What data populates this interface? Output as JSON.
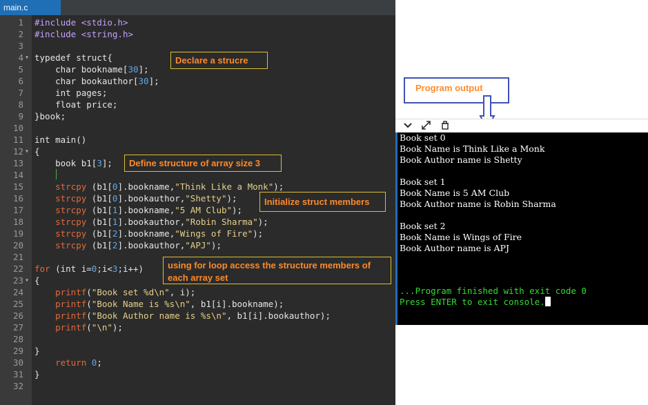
{
  "editor": {
    "tab": "main.c",
    "lines": [
      {
        "n": "1",
        "fold": "",
        "segs": [
          {
            "t": "#include ",
            "c": "inc"
          },
          {
            "t": "<stdio.h>",
            "c": "inc"
          }
        ]
      },
      {
        "n": "2",
        "fold": "",
        "segs": [
          {
            "t": "#include ",
            "c": "inc"
          },
          {
            "t": "<string.h>",
            "c": "inc"
          }
        ]
      },
      {
        "n": "3",
        "fold": "",
        "segs": []
      },
      {
        "n": "4",
        "fold": "▾",
        "segs": [
          {
            "t": "typedef struct{",
            "c": "kw"
          }
        ]
      },
      {
        "n": "5",
        "fold": "",
        "segs": [
          {
            "t": "    char bookname[",
            "c": "kw"
          },
          {
            "t": "30",
            "c": "num"
          },
          {
            "t": "];",
            "c": "kw"
          }
        ]
      },
      {
        "n": "6",
        "fold": "",
        "segs": [
          {
            "t": "    char bookauthor[",
            "c": "kw"
          },
          {
            "t": "30",
            "c": "num"
          },
          {
            "t": "];",
            "c": "kw"
          }
        ]
      },
      {
        "n": "7",
        "fold": "",
        "segs": [
          {
            "t": "    int pages;",
            "c": "kw"
          }
        ]
      },
      {
        "n": "8",
        "fold": "",
        "segs": [
          {
            "t": "    float price;",
            "c": "kw"
          }
        ]
      },
      {
        "n": "9",
        "fold": "",
        "segs": [
          {
            "t": "}book;",
            "c": "kw"
          }
        ]
      },
      {
        "n": "10",
        "fold": "",
        "segs": []
      },
      {
        "n": "11",
        "fold": "",
        "segs": [
          {
            "t": "int main()",
            "c": "kw"
          }
        ]
      },
      {
        "n": "12",
        "fold": "▾",
        "segs": [
          {
            "t": "{",
            "c": "kw"
          }
        ]
      },
      {
        "n": "13",
        "fold": "",
        "segs": [
          {
            "t": "    book b1[",
            "c": "kw"
          },
          {
            "t": "3",
            "c": "num"
          },
          {
            "t": "];",
            "c": "kw"
          }
        ]
      },
      {
        "n": "14",
        "fold": "",
        "segs": []
      },
      {
        "n": "15",
        "fold": "",
        "segs": [
          {
            "t": "    strcpy",
            "c": "fn"
          },
          {
            "t": " (b1[",
            "c": "kw"
          },
          {
            "t": "0",
            "c": "num"
          },
          {
            "t": "].bookname,",
            "c": "kw"
          },
          {
            "t": "\"Think Like a Monk\"",
            "c": "str"
          },
          {
            "t": ");",
            "c": "kw"
          }
        ]
      },
      {
        "n": "16",
        "fold": "",
        "segs": [
          {
            "t": "    strcpy",
            "c": "fn"
          },
          {
            "t": " (b1[",
            "c": "kw"
          },
          {
            "t": "0",
            "c": "num"
          },
          {
            "t": "].bookauthor,",
            "c": "kw"
          },
          {
            "t": "\"Shetty\"",
            "c": "str"
          },
          {
            "t": ");",
            "c": "kw"
          }
        ]
      },
      {
        "n": "17",
        "fold": "",
        "segs": [
          {
            "t": "    strcpy",
            "c": "fn"
          },
          {
            "t": " (b1[",
            "c": "kw"
          },
          {
            "t": "1",
            "c": "num"
          },
          {
            "t": "].bookname,",
            "c": "kw"
          },
          {
            "t": "\"5 AM Club\"",
            "c": "str"
          },
          {
            "t": ");",
            "c": "kw"
          }
        ]
      },
      {
        "n": "18",
        "fold": "",
        "segs": [
          {
            "t": "    strcpy",
            "c": "fn"
          },
          {
            "t": " (b1[",
            "c": "kw"
          },
          {
            "t": "1",
            "c": "num"
          },
          {
            "t": "].bookauthor,",
            "c": "kw"
          },
          {
            "t": "\"Robin Sharma\"",
            "c": "str"
          },
          {
            "t": ");",
            "c": "kw"
          }
        ]
      },
      {
        "n": "19",
        "fold": "",
        "segs": [
          {
            "t": "    strcpy",
            "c": "fn"
          },
          {
            "t": " (b1[",
            "c": "kw"
          },
          {
            "t": "2",
            "c": "num"
          },
          {
            "t": "].bookname,",
            "c": "kw"
          },
          {
            "t": "\"Wings of Fire\"",
            "c": "str"
          },
          {
            "t": ");",
            "c": "kw"
          }
        ]
      },
      {
        "n": "20",
        "fold": "",
        "segs": [
          {
            "t": "    strcpy",
            "c": "fn"
          },
          {
            "t": " (b1[",
            "c": "kw"
          },
          {
            "t": "2",
            "c": "num"
          },
          {
            "t": "].bookauthor,",
            "c": "kw"
          },
          {
            "t": "\"APJ\"",
            "c": "str"
          },
          {
            "t": ");",
            "c": "kw"
          }
        ]
      },
      {
        "n": "21",
        "fold": "",
        "segs": []
      },
      {
        "n": "22",
        "fold": "",
        "segs": [
          {
            "t": "for",
            "c": "fn"
          },
          {
            "t": " (int i=",
            "c": "kw"
          },
          {
            "t": "0",
            "c": "num"
          },
          {
            "t": ";i<",
            "c": "kw"
          },
          {
            "t": "3",
            "c": "num"
          },
          {
            "t": ";i++)",
            "c": "kw"
          }
        ]
      },
      {
        "n": "23",
        "fold": "▾",
        "segs": [
          {
            "t": "{",
            "c": "kw"
          }
        ]
      },
      {
        "n": "24",
        "fold": "",
        "segs": [
          {
            "t": "    printf",
            "c": "fn"
          },
          {
            "t": "(",
            "c": "kw"
          },
          {
            "t": "\"Book set %d\\n\"",
            "c": "str"
          },
          {
            "t": ", i);",
            "c": "kw"
          }
        ]
      },
      {
        "n": "25",
        "fold": "",
        "segs": [
          {
            "t": "    printf",
            "c": "fn"
          },
          {
            "t": "(",
            "c": "kw"
          },
          {
            "t": "\"Book Name is %s\\n\"",
            "c": "str"
          },
          {
            "t": ", b1[i].bookname);",
            "c": "kw"
          }
        ]
      },
      {
        "n": "26",
        "fold": "",
        "segs": [
          {
            "t": "    printf",
            "c": "fn"
          },
          {
            "t": "(",
            "c": "kw"
          },
          {
            "t": "\"Book Author name is %s\\n\"",
            "c": "str"
          },
          {
            "t": ", b1[i].bookauthor);",
            "c": "kw"
          }
        ]
      },
      {
        "n": "27",
        "fold": "",
        "segs": [
          {
            "t": "    printf",
            "c": "fn"
          },
          {
            "t": "(",
            "c": "kw"
          },
          {
            "t": "\"\\n\"",
            "c": "str"
          },
          {
            "t": ");",
            "c": "kw"
          }
        ]
      },
      {
        "n": "28",
        "fold": "",
        "segs": []
      },
      {
        "n": "29",
        "fold": "",
        "segs": [
          {
            "t": "}",
            "c": "kw"
          }
        ]
      },
      {
        "n": "30",
        "fold": "",
        "segs": [
          {
            "t": "    return ",
            "c": "fn"
          },
          {
            "t": "0",
            "c": "num"
          },
          {
            "t": ";",
            "c": "kw"
          }
        ]
      },
      {
        "n": "31",
        "fold": "",
        "segs": [
          {
            "t": "}",
            "c": "kw"
          }
        ]
      },
      {
        "n": "32",
        "fold": "",
        "segs": []
      }
    ]
  },
  "annotations": {
    "declare": "Declare a strucre",
    "define": "Define structure of array size 3",
    "initialize": "Initialize struct members",
    "loop": "using for loop access the structure members of each array set",
    "output": "Program output"
  },
  "console": {
    "toolbar_icons": [
      "chevron-down-icon",
      "expand-icon",
      "clear-console-icon"
    ],
    "lines": [
      "Book set 0",
      "Book Name is Think Like a Monk",
      "Book Author name is Shetty",
      "",
      "Book set 1",
      "Book Name is 5 AM Club",
      "Book Author name is Robin Sharma",
      "",
      "Book set 2",
      "Book Name is Wings of Fire",
      "Book Author name is APJ"
    ],
    "finished": "...Program finished with exit code 0",
    "prompt": "Press ENTER to exit console."
  },
  "colors": {
    "tab_active": "#1f6fb7",
    "editor_bg": "#2b2b2b",
    "annotation_border": "#e0c030",
    "annotation_text": "#ff8a2a",
    "console_green": "#33dd33",
    "arrow_blue": "#3f51b5"
  }
}
